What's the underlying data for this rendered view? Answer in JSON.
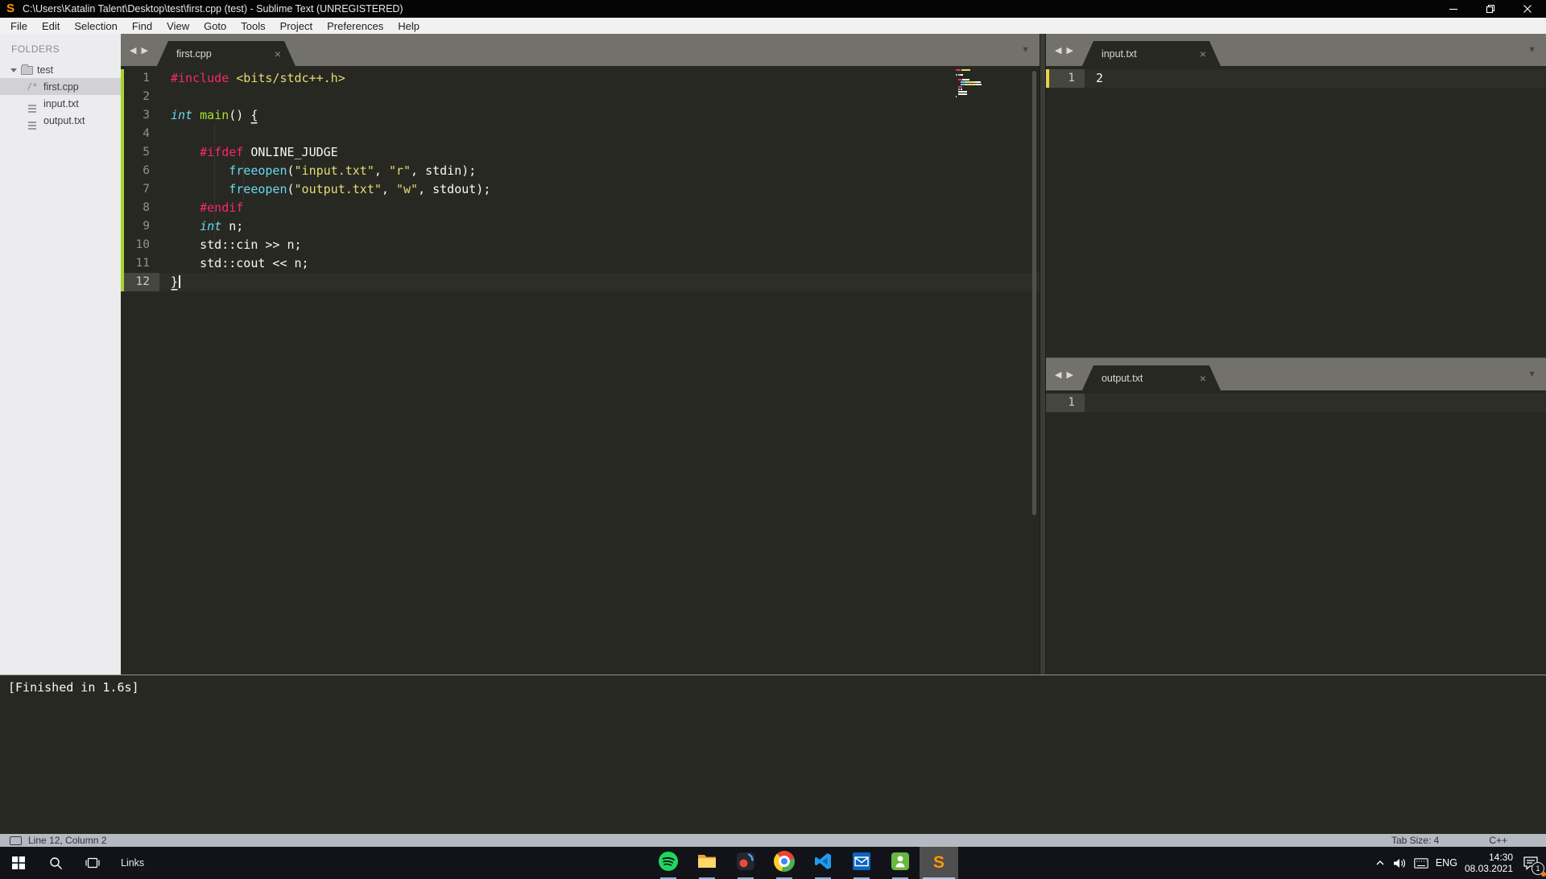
{
  "window": {
    "title": "C:\\Users\\Katalin Talent\\Desktop\\test\\first.cpp (test) - Sublime Text (UNREGISTERED)",
    "controls": [
      "minimize",
      "restore",
      "close"
    ]
  },
  "menu": {
    "items": [
      "File",
      "Edit",
      "Selection",
      "Find",
      "View",
      "Goto",
      "Tools",
      "Project",
      "Preferences",
      "Help"
    ]
  },
  "sidebar": {
    "header": "FOLDERS",
    "folder_name": "test",
    "files": [
      {
        "label": "first.cpp",
        "icon": "cpp-file-icon",
        "selected": true
      },
      {
        "label": "input.txt",
        "icon": "text-file-icon",
        "selected": false
      },
      {
        "label": "output.txt",
        "icon": "text-file-icon",
        "selected": false
      }
    ]
  },
  "palette": {
    "keyword": "#f92672",
    "string": "#e6db74",
    "type": "#66d9ef",
    "function": "#a6e22e",
    "call": "#66d9ef",
    "plain": "#f8f8f2",
    "added": "#a7d32c",
    "modified": "#e5d44c",
    "background": "#272822"
  },
  "editors": [
    {
      "tab_label": "first.cpp",
      "active_line": 12,
      "all_added": true,
      "lines": [
        {
          "n": 1,
          "seg": [
            [
              "kw",
              "#include"
            ],
            [
              "pl",
              " "
            ],
            [
              "str",
              "<bits/stdc++.h>"
            ]
          ]
        },
        {
          "n": 2,
          "seg": []
        },
        {
          "n": 3,
          "seg": [
            [
              "type",
              "int"
            ],
            [
              "pl",
              " "
            ],
            [
              "fn",
              "main"
            ],
            [
              "pl",
              "() "
            ],
            [
              "brace",
              "{"
            ]
          ]
        },
        {
          "n": 4,
          "seg": []
        },
        {
          "n": 5,
          "seg": [
            [
              "pl",
              "    "
            ],
            [
              "kw",
              "#ifdef"
            ],
            [
              "pl",
              " ONLINE_JUDGE"
            ]
          ]
        },
        {
          "n": 6,
          "seg": [
            [
              "pl",
              "        "
            ],
            [
              "call",
              "freeopen"
            ],
            [
              "pl",
              "("
            ],
            [
              "str",
              "\"input.txt\""
            ],
            [
              "pl",
              ", "
            ],
            [
              "str",
              "\"r\""
            ],
            [
              "pl",
              ", stdin);"
            ]
          ]
        },
        {
          "n": 7,
          "seg": [
            [
              "pl",
              "        "
            ],
            [
              "call",
              "freeopen"
            ],
            [
              "pl",
              "("
            ],
            [
              "str",
              "\"output.txt\""
            ],
            [
              "pl",
              ", "
            ],
            [
              "str",
              "\"w\""
            ],
            [
              "pl",
              ", stdout);"
            ]
          ]
        },
        {
          "n": 8,
          "seg": [
            [
              "pl",
              "    "
            ],
            [
              "kw",
              "#endif"
            ]
          ]
        },
        {
          "n": 9,
          "seg": [
            [
              "pl",
              "    "
            ],
            [
              "type",
              "int"
            ],
            [
              "pl",
              " n;"
            ]
          ]
        },
        {
          "n": 10,
          "seg": [
            [
              "pl",
              "    std::cin >> n;"
            ]
          ]
        },
        {
          "n": 11,
          "seg": [
            [
              "pl",
              "    std::cout << n;"
            ]
          ]
        },
        {
          "n": 12,
          "seg": [
            [
              "brace",
              "}"
            ],
            [
              "caret",
              ""
            ]
          ]
        }
      ]
    },
    {
      "tab_label": "input.txt",
      "active_line": 1,
      "all_added": false,
      "lines": [
        {
          "n": 1,
          "seg": [
            [
              "pl",
              "2"
            ]
          ],
          "modified": true
        }
      ]
    },
    {
      "tab_label": "output.txt",
      "active_line": 1,
      "all_added": false,
      "lines": [
        {
          "n": 1,
          "seg": []
        }
      ]
    }
  ],
  "console": {
    "text": "[Finished in 1.6s]"
  },
  "status": {
    "position": "Line 12, Column 2",
    "tab_size": "Tab Size: 4",
    "syntax": "C++"
  },
  "taskbar": {
    "links_label": "Links",
    "apps": [
      {
        "name": "spotify"
      },
      {
        "name": "file-explorer"
      },
      {
        "name": "media-app"
      },
      {
        "name": "chrome"
      },
      {
        "name": "vscode"
      },
      {
        "name": "mail"
      },
      {
        "name": "android-app"
      },
      {
        "name": "sublime-text",
        "active": true
      }
    ],
    "tray": {
      "language": "ENG",
      "time": "14:30",
      "date": "08.03.2021",
      "notification_count": "1"
    }
  }
}
